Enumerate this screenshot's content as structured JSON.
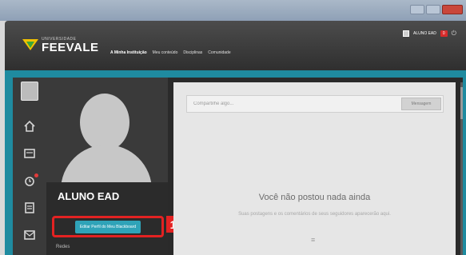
{
  "window": {
    "controls": [
      "minimize-icon",
      "maximize-icon",
      "close-icon"
    ]
  },
  "header": {
    "logo_small": "UNIVERSIDADE",
    "logo_main": "FEEVALE",
    "nav": [
      "A Minha Instituição",
      "Meu conteúdo",
      "Disciplinas",
      "Comunidade"
    ],
    "user_name": "ALUNO EAD",
    "notifications": "0"
  },
  "rail": {
    "items": [
      "avatar",
      "home-icon",
      "courses-icon",
      "alarm-icon",
      "grades-icon",
      "messages-icon"
    ]
  },
  "profile": {
    "name": "ALUNO EAD",
    "edit_button": "Editar Perfil do Meu Blackboard",
    "callout": "1",
    "bottom_text": "Redes"
  },
  "feed": {
    "post_placeholder": "Compartilhe algo...",
    "post_button": "Mensagem",
    "empty_title": "Você não postou nada ainda",
    "empty_desc": "Suas postagens e os comentários de seus seguidores aparecerão aqui."
  },
  "colors": {
    "accent": "#2fa3b8",
    "frame": "#1f8ba0",
    "highlight": "#e32222",
    "header": "#3a3a3a"
  }
}
